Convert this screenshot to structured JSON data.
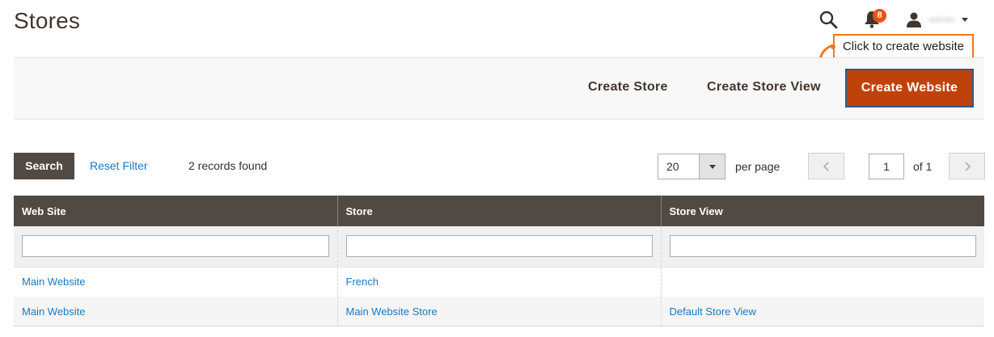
{
  "header": {
    "title": "Stores",
    "notification_count": "8",
    "user_name": "admin"
  },
  "callout": {
    "text": "Click to create website",
    "color": "#eb7b1e"
  },
  "action_bar": {
    "create_store": "Create Store",
    "create_store_view": "Create Store View",
    "create_website": "Create Website",
    "primary_color": "#c0420b"
  },
  "toolbar": {
    "search": "Search",
    "reset_filter": "Reset Filter",
    "records_found": "2 records found",
    "per_page_value": "20",
    "per_page_label": "per page",
    "current_page": "1",
    "of_pages": "of 1"
  },
  "grid": {
    "columns": [
      "Web Site",
      "Store",
      "Store View"
    ],
    "rows": [
      [
        "Main Website",
        "French",
        ""
      ],
      [
        "Main Website",
        "Main Website Store",
        "Default Store View"
      ]
    ]
  },
  "colors": {
    "header_bg": "#514943",
    "link": "#1979c3",
    "badge": "#eb5202"
  }
}
